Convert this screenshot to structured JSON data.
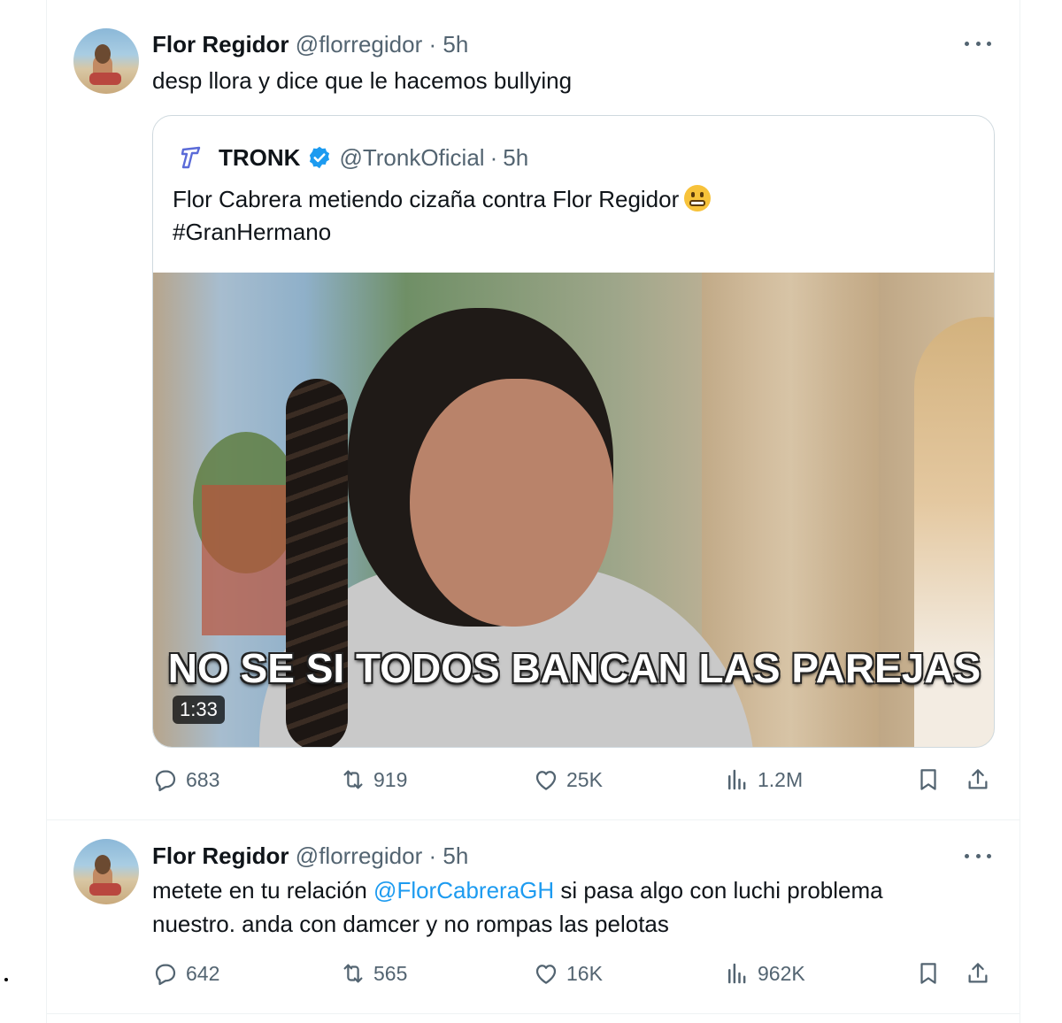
{
  "tweets": [
    {
      "author": {
        "name": "Flor Regidor",
        "handle": "@florregidor",
        "separator": "·",
        "time": "5h"
      },
      "text": "desp llora y dice que le hacemos bullying",
      "quote": {
        "author": {
          "name": "TRONK",
          "handle": "@TronkOficial",
          "separator": "·",
          "time": "5h",
          "verified": true
        },
        "text_line1": "Flor Cabrera metiendo cizaña contra Flor Regidor",
        "emoji": "grimacing-face",
        "text_line2": "#GranHermano",
        "media": {
          "caption": "NO SE SI TODOS BANCAN LAS PAREJAS",
          "duration": "1:33"
        }
      },
      "stats": {
        "replies": "683",
        "reposts": "919",
        "likes": "25K",
        "views": "1.2M"
      }
    },
    {
      "author": {
        "name": "Flor Regidor",
        "handle": "@florregidor",
        "separator": "·",
        "time": "5h"
      },
      "text_before": "metete en tu relación ",
      "mention": "@FlorCabreraGH",
      "text_after": " si pasa algo con luchi problema nuestro. anda con damcer y no rompas las pelotas",
      "stats": {
        "replies": "642",
        "reposts": "565",
        "likes": "16K",
        "views": "962K"
      }
    }
  ],
  "colors": {
    "text": "#0f1419",
    "secondary": "#536471",
    "link": "#1d9bf0",
    "verified": "#1d9bf0",
    "border": "#eff3f4"
  },
  "icons": [
    "more-icon",
    "reply-icon",
    "repost-icon",
    "like-icon",
    "views-icon",
    "bookmark-icon",
    "share-icon",
    "verified-badge-icon",
    "tronk-logo-icon"
  ]
}
